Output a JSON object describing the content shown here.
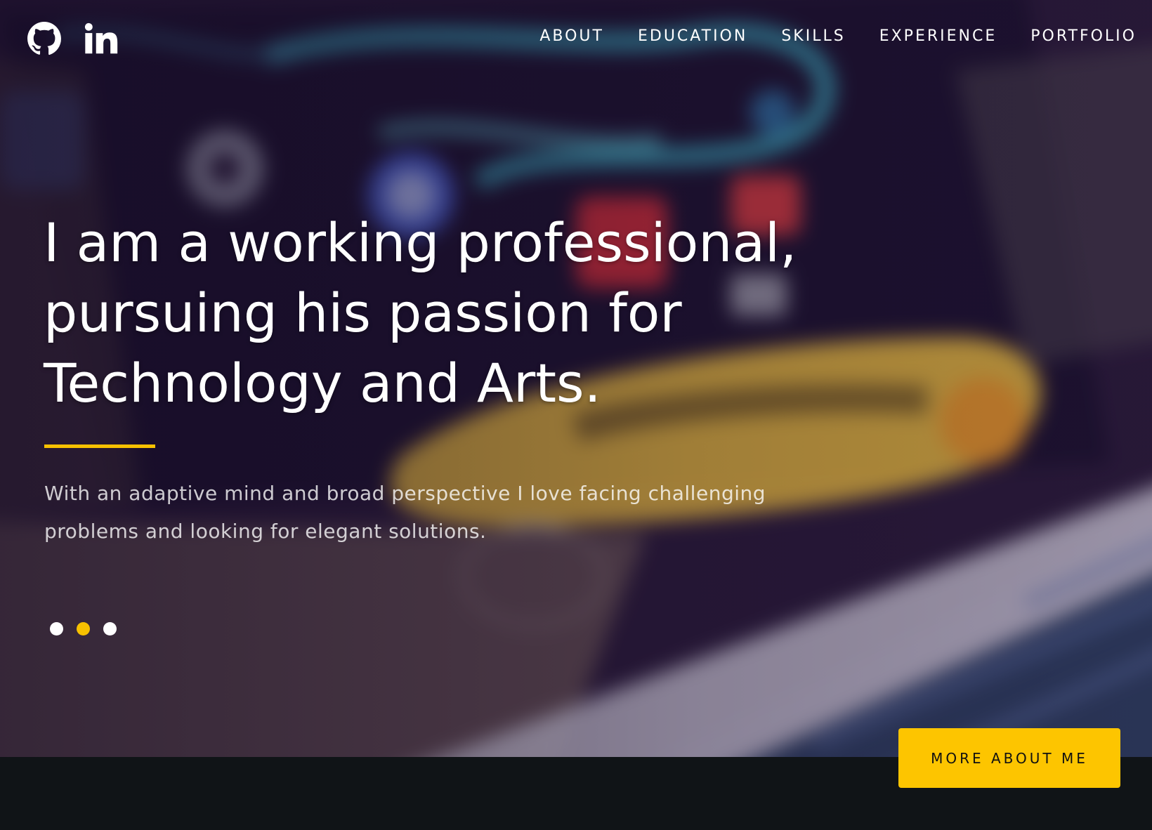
{
  "social": {
    "github_icon": "github-icon",
    "linkedin_icon": "linkedin-icon"
  },
  "nav": {
    "items": [
      {
        "label": "ABOUT"
      },
      {
        "label": "EDUCATION"
      },
      {
        "label": "SKILLS"
      },
      {
        "label": "EXPERIENCE"
      },
      {
        "label": "PORTFOLIO"
      }
    ]
  },
  "hero": {
    "headline": "I am a working professional, pursuing his passion for Technology and Arts.",
    "lead": "With an adaptive mind and broad perspective I love facing challenging problems and looking for elegant solutions.",
    "slides": {
      "count": 3,
      "active_index": 1
    },
    "cta_label": "MORE ABOUT ME"
  },
  "colors": {
    "accent": "#fdc500",
    "nav_text": "#ffffff",
    "footer_bg": "#101417"
  }
}
